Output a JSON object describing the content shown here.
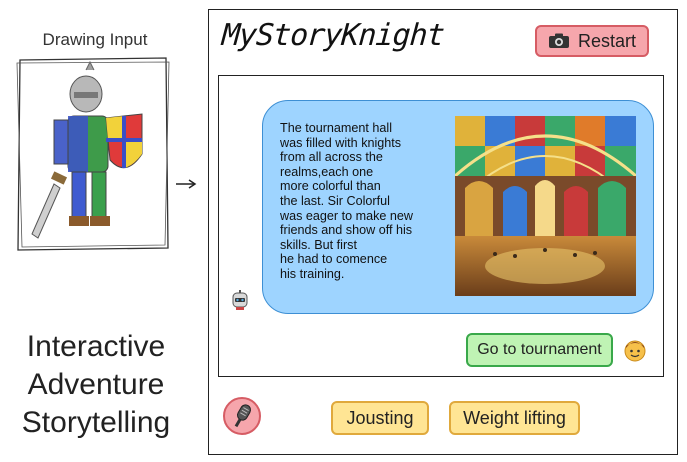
{
  "left_panel": {
    "drawing_label": "Drawing Input",
    "tagline": "Interactive\nAdventure\nStorytelling"
  },
  "app": {
    "title": "MyStoryKnight",
    "restart_label": "Restart",
    "restart_icon": "camera-icon",
    "story_text": "The tournament hall\nwas filled with knights\nfrom all across the\nrealms,each one\nmore colorful than\nthe last. Sir Colorful\nwas eager to make new\nfriends and show off his\nskills. But first\nhe had to comence\nhis training.",
    "bot_icon": "robot-icon",
    "user_reply": "Go to tournament",
    "user_icon": "child-face-icon",
    "mic_icon": "microphone-icon",
    "choices": [
      "Jousting",
      "Weight lifting"
    ]
  },
  "colors": {
    "restart_bg": "#f6a6ac",
    "bubble_bg": "#9ed4ff",
    "reply_bg": "#bff3b4",
    "choice_bg": "#ffe594"
  }
}
